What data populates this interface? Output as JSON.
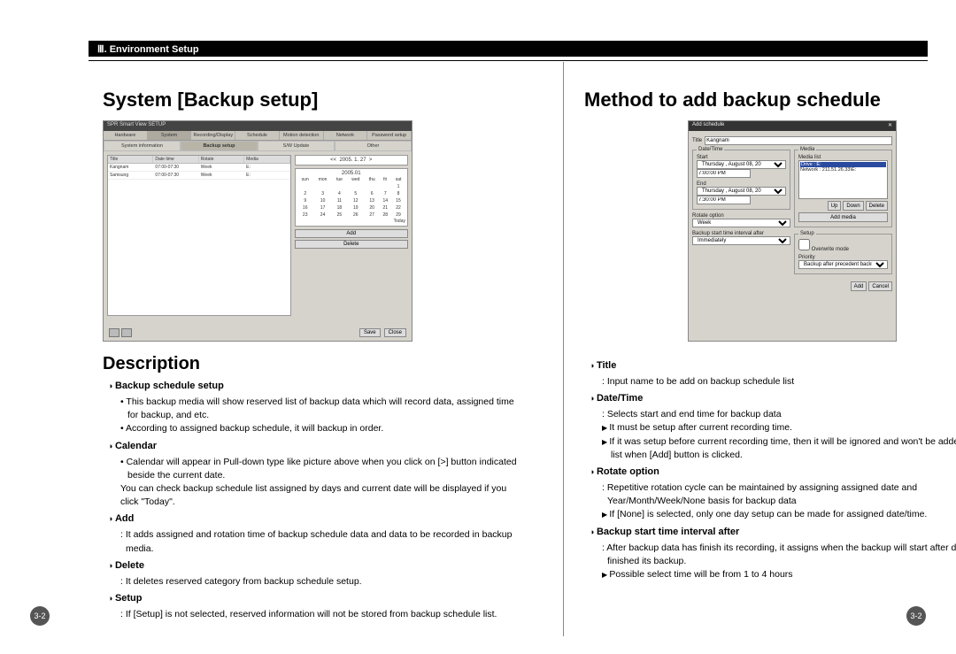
{
  "header": {
    "chapter": "Ⅲ. Environment Setup"
  },
  "page_number": "3-2",
  "left": {
    "title": "System [Backup setup]",
    "shot": {
      "window_title": "SPR Smart View SETUP",
      "tabs": [
        "Hardware",
        "System",
        "Recording/Display",
        "Schedule",
        "Motion detection",
        "Network",
        "Password setup"
      ],
      "active_tab": "System",
      "subtabs": [
        "System information",
        "Backup setup",
        "S/W Update",
        "Other"
      ],
      "active_subtab": "Backup setup",
      "list_headers": [
        "Title",
        "Date time",
        "Rotate",
        "Media"
      ],
      "list_rows": [
        [
          "Kangnam",
          "07:00-07:30",
          "Week",
          "E:"
        ],
        [
          "Samsung",
          "07:00-07:30",
          "Week",
          "E:"
        ]
      ],
      "calendar": {
        "nav_date": "2005. 1. 27",
        "month": "2005.01",
        "dow": [
          "sun",
          "mon",
          "tue",
          "wed",
          "thu",
          "fri",
          "sat"
        ],
        "weeks": [
          [
            "",
            "",
            "",
            "",
            "",
            "",
            "1"
          ],
          [
            "2",
            "3",
            "4",
            "5",
            "6",
            "7",
            "8"
          ],
          [
            "9",
            "10",
            "11",
            "12",
            "13",
            "14",
            "15"
          ],
          [
            "16",
            "17",
            "18",
            "19",
            "20",
            "21",
            "22"
          ],
          [
            "23",
            "24",
            "25",
            "26",
            "27",
            "28",
            "29"
          ]
        ],
        "today_label": "Today"
      },
      "buttons": {
        "add": "Add",
        "delete": "Delete",
        "save": "Save",
        "close": "Close"
      }
    },
    "desc_title": "Description",
    "items": {
      "backup_setup": {
        "h": "Backup schedule setup",
        "b1": "This backup media will show reserved list of backup data which will record data, assigned time for backup, and etc.",
        "b2": "According to assigned backup schedule, it will backup in order."
      },
      "calendar": {
        "h": "Calendar",
        "b1": "Calendar will appear in Pull-down type like picture above when you click on [>] button indicated beside the current date.",
        "b2": "You can check backup schedule list assigned by days and current date will be displayed if you click \"Today\"."
      },
      "add": {
        "h": "Add",
        "c1": "It adds assigned and rotation time of backup schedule data and data to be recorded in backup media."
      },
      "delete": {
        "h": "Delete",
        "c1": "It deletes reserved category from backup schedule setup."
      },
      "setup": {
        "h": "Setup",
        "c1": "If [Setup] is not selected, reserved information will not be stored from backup schedule list."
      }
    }
  },
  "right": {
    "title": "Method to add backup schedule",
    "shot": {
      "window_title": "Add schedule",
      "title_label": "Title",
      "title_value": "Kangnam",
      "date_time_label": "Date/Time",
      "start_label": "Start",
      "start_date": "Thursday , August   08, 20",
      "start_time": "7:00:00 PM",
      "end_label": "End",
      "end_date": "Thursday , August   08, 20",
      "end_time": "7:30:00 PM",
      "rotate_label": "Rotate option",
      "rotate_value": "Week",
      "interval_label": "Backup start time interval after",
      "interval_value": "Immediately",
      "media_label": "Media",
      "media_list_label": "Media list",
      "media_items": [
        "Drive : E:",
        "Network : 211.51.26.33\\E:"
      ],
      "btn_up": "Up",
      "btn_down": "Down",
      "btn_del": "Delete",
      "btn_addmedia": "Add media",
      "setup_label": "Setup",
      "overwrite": "Overwrite mode",
      "priority_label": "Priority",
      "priority_value": "Backup after precedent backup",
      "btn_add": "Add",
      "btn_cancel": "Cancel"
    },
    "items": {
      "title": {
        "h": "Title",
        "c1": "Input name to be add on backup schedule list"
      },
      "datetime": {
        "h": "Date/Time",
        "c1": "Selects start and end time for backup data",
        "a1": "It must be setup after current recording time.",
        "a2": "If it was setup before current recording time, then it will be ignored and won't be added to the list when [Add] button is clicked."
      },
      "rotate": {
        "h": "Rotate option",
        "c1": "Repetitive rotation cycle can be maintained by assigning assigned date and Year/Month/Week/None basis for backup data",
        "a1": "If [None] is selected, only one day setup can be made for assigned date/time."
      },
      "interval": {
        "h": "Backup start time interval after",
        "c1": "After backup data has finish its recording, it assigns when the backup will start after data has finished its backup.",
        "a1": "Possible select time will be from 1 to 4 hours"
      }
    }
  }
}
